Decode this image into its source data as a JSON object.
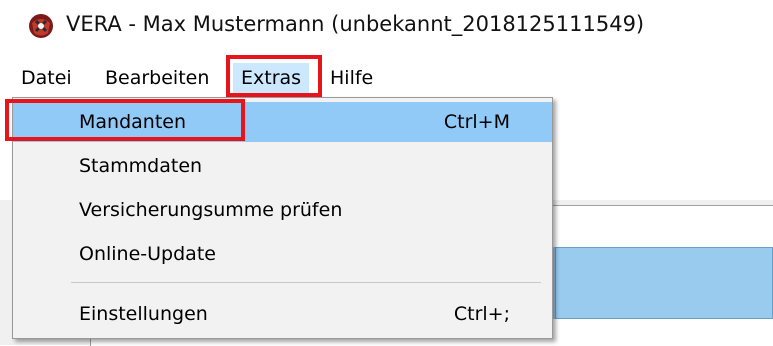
{
  "window": {
    "title": "VERA - Max Mustermann (unbekannt_2018125111549)",
    "icon": "app-logo-icon"
  },
  "menubar": {
    "items": [
      {
        "label": "Datei"
      },
      {
        "label": "Bearbeiten"
      },
      {
        "label": "Extras",
        "active": true
      },
      {
        "label": "Hilfe"
      }
    ]
  },
  "dropdown": {
    "items": [
      {
        "label": "Mandanten",
        "shortcut": "Ctrl+M",
        "selected": true
      },
      {
        "label": "Stammdaten",
        "shortcut": ""
      },
      {
        "label": "Versicherungsumme prüfen",
        "shortcut": ""
      },
      {
        "label": "Online-Update",
        "shortcut": ""
      },
      {
        "label": "Einstellungen",
        "shortcut": "Ctrl+;"
      }
    ]
  },
  "colors": {
    "highlight_box": "#e8141c",
    "menu_selected": "#91c9f7",
    "menubar_active": "#cce8ff"
  }
}
